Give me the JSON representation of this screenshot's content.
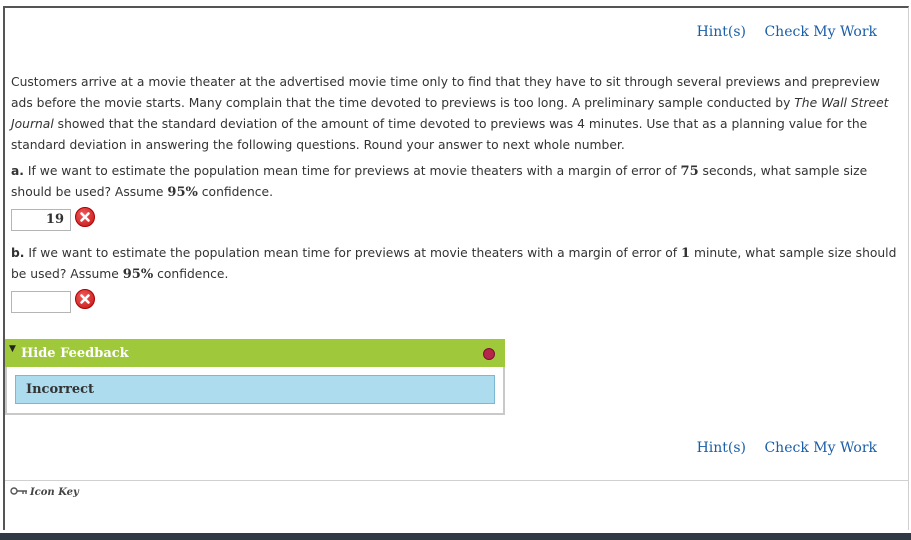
{
  "nav": {
    "hint_label": "Hint(s)",
    "check_label": "Check My Work"
  },
  "question": {
    "intro_before_italic": "Customers arrive at a movie theater at the advertised movie time only to find that they have to sit through several previews and prepreview ads before the movie starts. Many complain that the time devoted to previews is too long. A preliminary sample conducted by ",
    "intro_italic": "The Wall Street Journal",
    "intro_after_italic": " showed that the standard deviation of the amount of time devoted to previews was 4 minutes. Use that as a planning value for the standard deviation in answering the following questions. Round your answer to next whole number.",
    "part_a": {
      "label": "a.",
      "text_1": " If we want to estimate the population mean time for previews at movie theaters with a margin of error of ",
      "value_1": "75",
      "text_2": " seconds, what sample size should be used? Assume ",
      "value_2": "95%",
      "text_3": " confidence.",
      "answer": "19"
    },
    "part_b": {
      "label": "b.",
      "text_1": " If we want to estimate the population mean time for previews at movie theaters with a margin of error of ",
      "value_1": "1",
      "text_2": " minute, what sample size should be used? Assume ",
      "value_2": "95%",
      "text_3": " confidence.",
      "answer": ""
    }
  },
  "feedback": {
    "title": "Hide Feedback",
    "message": "Incorrect"
  },
  "footer": {
    "icon_key_label": "Icon Key"
  },
  "icons": {
    "incorrect": "x-circle-icon",
    "key": "key-icon",
    "close": "close-icon",
    "collapse": "triangle-down-icon"
  },
  "colors": {
    "link": "#1a5ea8",
    "feedback_header": "#9fc93a",
    "feedback_body": "#aedcef",
    "error": "#c41414"
  }
}
